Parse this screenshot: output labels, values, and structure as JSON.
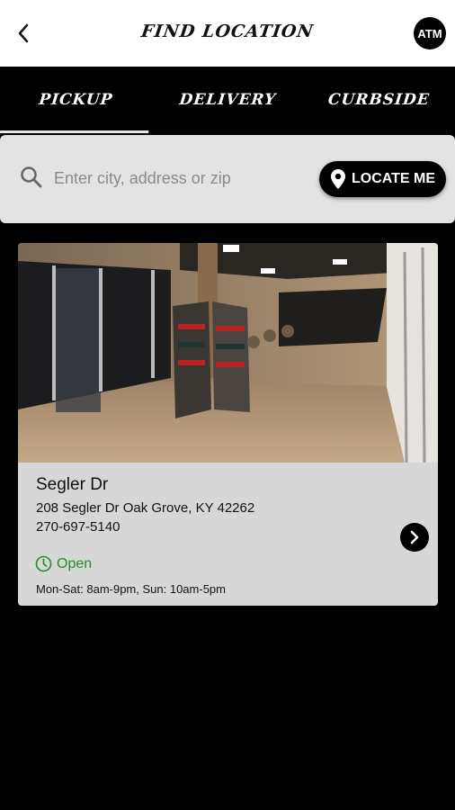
{
  "header": {
    "title": "FIND LOCATION",
    "account_badge": "ATM",
    "back_icon": "chevron-left-icon"
  },
  "tabs": [
    {
      "label": "PICKUP",
      "active": true
    },
    {
      "label": "DELIVERY",
      "active": false
    },
    {
      "label": "CURBSIDE",
      "active": false
    }
  ],
  "search": {
    "placeholder": "Enter city, address or zip",
    "value": "",
    "locate_label": "LOCATE ME"
  },
  "store": {
    "name": "Segler Dr",
    "address": "208 Segler Dr Oak Grove, KY 42262",
    "phone": "270-697-5140",
    "status": "Open",
    "hours": "Mon-Sat: 8am-9pm, Sun: 10am-5pm"
  },
  "colors": {
    "accent": "#000000",
    "open_status": "#2a8a2a",
    "card_bg": "#d7d7d7",
    "search_bg": "#e3e3e3"
  }
}
